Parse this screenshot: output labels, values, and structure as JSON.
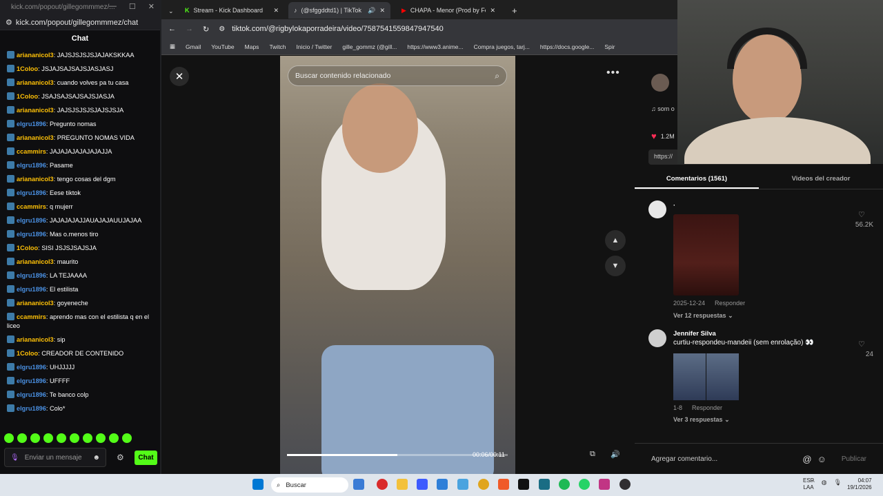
{
  "kick": {
    "tab_url_dim": "kick.com/popout/gillegommmez/...",
    "url": "kick.com/popout/gillegommmez/chat",
    "title": "Chat",
    "messages": [
      {
        "user": "ariananicol3",
        "color": "#ffc107",
        "text": ": JAJSJSJSJSJAJAKSKKAA"
      },
      {
        "user": "1Coloo",
        "color": "#ffc107",
        "text": ": JSJAJSAJSAJSJASJASJ"
      },
      {
        "user": "ariananicol3",
        "color": "#ffc107",
        "text": ": cuando volves pa tu casa"
      },
      {
        "user": "1Coloo",
        "color": "#ffc107",
        "text": ": JSAJSAJSAJSAJSJASJA"
      },
      {
        "user": "ariananicol3",
        "color": "#ffc107",
        "text": ": JAJSJSJSJSJAJSJSJA"
      },
      {
        "user": "elgru1896",
        "color": "#4a90e2",
        "text": ": Pregunto nomas"
      },
      {
        "user": "ariananicol3",
        "color": "#ffc107",
        "text": ": PREGUNTO NOMAS VIDA"
      },
      {
        "user": "ccammirs",
        "color": "#ffc107",
        "text": ": JAJAJAJAJAJAJAJJA"
      },
      {
        "user": "elgru1896",
        "color": "#4a90e2",
        "text": ": Pasame"
      },
      {
        "user": "ariananicol3",
        "color": "#ffc107",
        "text": ": tengo cosas del dgm"
      },
      {
        "user": "elgru1896",
        "color": "#4a90e2",
        "text": ": Eese tiktok"
      },
      {
        "user": "ccammirs",
        "color": "#ffc107",
        "text": ": q mujerr"
      },
      {
        "user": "elgru1896",
        "color": "#4a90e2",
        "text": ": JAJAJAJAJJAUAJAJAUUJAJAA"
      },
      {
        "user": "elgru1896",
        "color": "#4a90e2",
        "text": ": Mas o.menos tiro"
      },
      {
        "user": "1Coloo",
        "color": "#ffc107",
        "text": ": SISI JSJSJSAJSJA"
      },
      {
        "user": "ariananicol3",
        "color": "#ffc107",
        "text": ": maurito"
      },
      {
        "user": "elgru1896",
        "color": "#4a90e2",
        "text": ": LA TEJAAAA"
      },
      {
        "user": "elgru1896",
        "color": "#4a90e2",
        "text": ": El estilista"
      },
      {
        "user": "ariananicol3",
        "color": "#ffc107",
        "text": ": goyeneche"
      },
      {
        "user": "ccammirs",
        "color": "#ffc107",
        "text": ": aprendo mas con el estilista q en el liceo"
      },
      {
        "user": "ariananicol3",
        "color": "#ffc107",
        "text": ": sip"
      },
      {
        "user": "1Coloo",
        "color": "#ffc107",
        "text": ": CREADOR DE CONTENIDO"
      },
      {
        "user": "elgru1896",
        "color": "#4a90e2",
        "text": ": UHJJJJJ"
      },
      {
        "user": "elgru1896",
        "color": "#4a90e2",
        "text": ": UFFFF"
      },
      {
        "user": "elgru1896",
        "color": "#4a90e2",
        "text": ": Te banco colp"
      },
      {
        "user": "elgru1896",
        "color": "#4a90e2",
        "text": ": Colo*"
      }
    ],
    "input_placeholder": "Enviar un mensaje",
    "send_label": "Chat",
    "accent": "#53fc18"
  },
  "browser": {
    "tabs": [
      {
        "label": "Stream - Kick Dashboard",
        "icon": "kick-icon"
      },
      {
        "label": "(@sfggddtd1) | TikTok",
        "icon": "tiktok-icon"
      },
      {
        "label": "CHAPA - Menor (Prod by Feich",
        "icon": "youtube-icon"
      }
    ],
    "url": "tiktok.com/@rigbylokaporradeira/video/7587541559847947540",
    "bookmarks": [
      "Gmail",
      "YouTube",
      "Maps",
      "Twitch",
      "Inicio / Twitter",
      "gille_gommz (@gill...",
      "https://www3.anime...",
      "Compra juegos, tarj...",
      "https://docs.google...",
      "Spir"
    ]
  },
  "tiktok": {
    "search_placeholder": "Buscar contenido relacionado",
    "video_progress": 0.5,
    "timecode": "00:06/00:11",
    "music": "som o",
    "likes": "1.2M",
    "link": "https://",
    "tab_comments": "Comentarios (1561)",
    "tab_creator": "Videos del creador",
    "comments": [
      {
        "name": "·",
        "text": "",
        "date": "2025-12-24",
        "reply": "Responder",
        "replies": "Ver 12 respuestas",
        "likes": "56.2K"
      },
      {
        "name": "Jennifer Silva",
        "text": "curtiu-respondeu-mandeii (sem enrolação) 👀",
        "date": "1-8",
        "reply": "Responder",
        "replies": "Ver 3 respuestas",
        "likes": "24"
      }
    ],
    "add_comment": "Agregar comentario...",
    "publish": "Publicar"
  },
  "taskbar": {
    "search": "Buscar",
    "lang": "ESP",
    "lang2": "LAA",
    "time": "04:07",
    "date": "19/1/2026"
  }
}
